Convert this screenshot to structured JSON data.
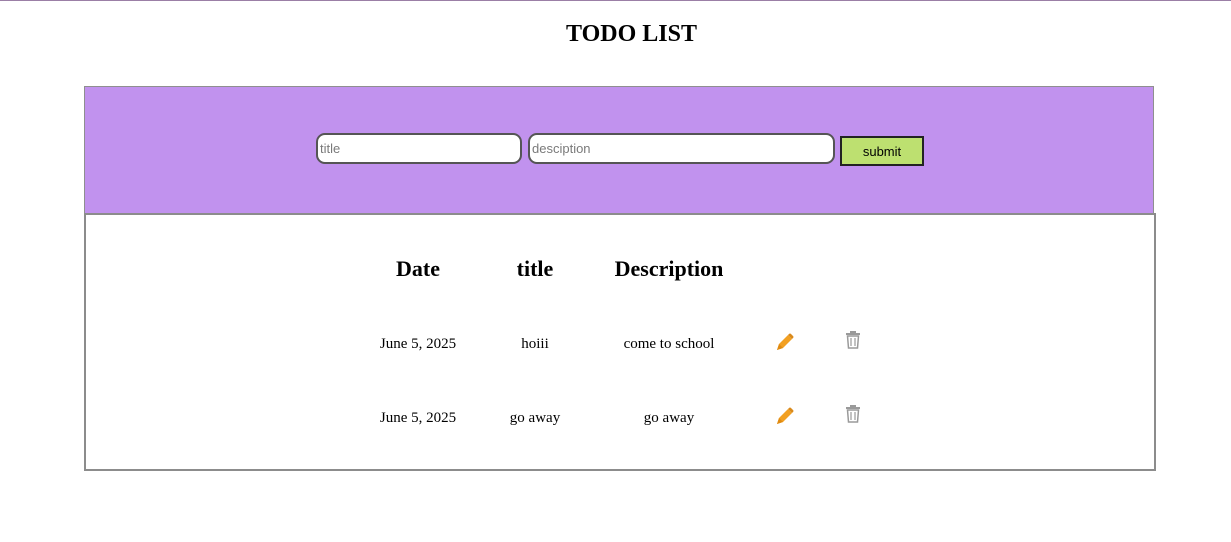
{
  "page": {
    "title": "TODO LIST"
  },
  "form": {
    "title_placeholder": "title",
    "description_placeholder": "desciption",
    "submit_label": "submit",
    "panel_color": "#c192ee",
    "submit_color": "#bde070"
  },
  "table": {
    "headers": {
      "date": "Date",
      "title": "title",
      "description": "Description"
    },
    "rows": [
      {
        "date": "June 5, 2025",
        "title": "hoiii",
        "description": "come to school",
        "edit_icon": "pencil-icon",
        "delete_icon": "trash-icon"
      },
      {
        "date": "June 5, 2025",
        "title": "go away",
        "description": "go away",
        "edit_icon": "pencil-icon",
        "delete_icon": "trash-icon"
      }
    ]
  },
  "colors": {
    "edit_icon": "#f2a022",
    "delete_icon": "#9a9a9a"
  }
}
